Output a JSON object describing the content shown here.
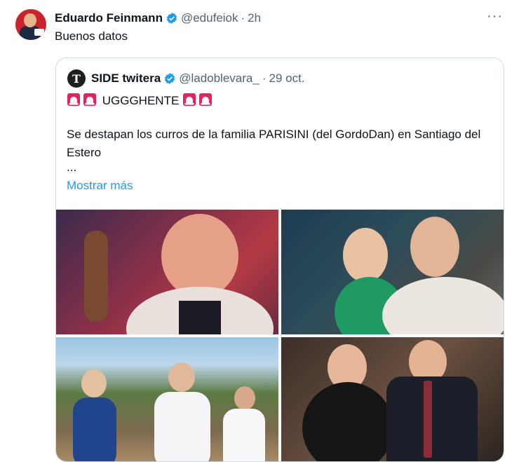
{
  "tweet": {
    "author_name": "Eduardo Feinmann",
    "handle": "@edufeiok",
    "separator": "·",
    "time": "2h",
    "text": "Buenos datos",
    "more_icon": "more-icon",
    "more_glyph": "···"
  },
  "quote": {
    "avatar_letter": "T",
    "author_name": "SIDE twitera",
    "handle": "@ladoblevara_",
    "separator": "·",
    "time": "29 oct.",
    "headline": "UGGGHENTE",
    "body": "Se destapan los curros de la familia PARISINI (del GordoDan) en Santiago del Estero",
    "ellipsis": "...",
    "show_more": "Mostrar más"
  },
  "colors": {
    "verified": "#1d9bf0",
    "link": "#1d9bf0",
    "siren": "#e0245e"
  }
}
